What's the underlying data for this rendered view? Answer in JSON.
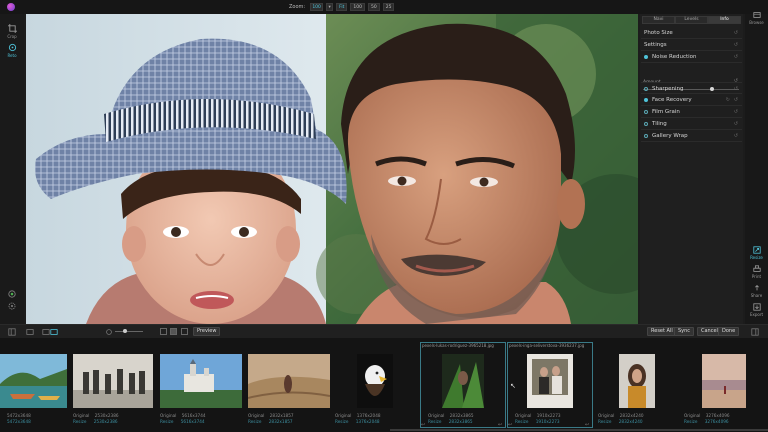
{
  "zoom": {
    "label": "Zoom:",
    "value": "100",
    "presets": [
      "Fit",
      "100",
      "50",
      "25"
    ]
  },
  "left_tools": [
    {
      "label": "Crop",
      "icon": "crop-icon"
    },
    {
      "label": "Reto",
      "icon": "retouch-icon"
    }
  ],
  "panel": {
    "tabs": [
      "Navi",
      "Levels",
      "Info"
    ],
    "active_tab": "Info",
    "rows": [
      {
        "label": "Photo Size",
        "dot": "none"
      },
      {
        "label": "Settings",
        "dot": "none"
      },
      {
        "label": "Noise Reduction",
        "dot": "on"
      },
      {
        "label": "Sharpening",
        "dot": "off"
      },
      {
        "label": "Face Recovery",
        "dot": "on"
      },
      {
        "label": "Film Grain",
        "dot": "off"
      },
      {
        "label": "Tiling",
        "dot": "off"
      },
      {
        "label": "Gallery Wrap",
        "dot": "off"
      }
    ],
    "amount_label": "Amount",
    "amount_value": 0.72
  },
  "rail": [
    {
      "label": "Browse",
      "icon": "browse-icon"
    },
    {
      "label": "Resize",
      "icon": "resize-icon",
      "active": true
    },
    {
      "label": "Print",
      "icon": "print-icon"
    },
    {
      "label": "Share",
      "icon": "share-icon"
    },
    {
      "label": "Export",
      "icon": "export-icon"
    }
  ],
  "toolbar": {
    "preview": "Preview",
    "reset_all": "Reset All",
    "sync": "Sync",
    "cancel": "Cancel",
    "done": "Done"
  },
  "filmstrip": [
    {
      "name": "",
      "original": "5472x3648",
      "resize": "5472x3648",
      "labels": false
    },
    {
      "name": "",
      "original": "2530x2386",
      "resize": "2530x2386",
      "labels": true
    },
    {
      "name": "",
      "original": "5616x3744",
      "resize": "5616x3744",
      "labels": true
    },
    {
      "name": "",
      "original": "2832x1857",
      "resize": "2832x1857",
      "labels": true
    },
    {
      "name": "",
      "original": "1376x2048",
      "resize": "1376x2048",
      "labels": true
    },
    {
      "name": "pexels-lukas-rodriguez-3965218.jpg",
      "original": "2832x3865",
      "resize": "2832x3865",
      "labels": true,
      "selected": true
    },
    {
      "name": "pexels-inga-seliverstova-3936237.jpg",
      "original": "1910x2273",
      "resize": "1910x2273",
      "labels": true,
      "selected": true
    },
    {
      "name": "",
      "original": "2832x4240",
      "resize": "2832x4240",
      "labels": true
    },
    {
      "name": "",
      "original": "3276x4096",
      "resize": "3276x4096",
      "labels": true
    }
  ],
  "labels": {
    "original": "Original",
    "resize": "Resize"
  }
}
